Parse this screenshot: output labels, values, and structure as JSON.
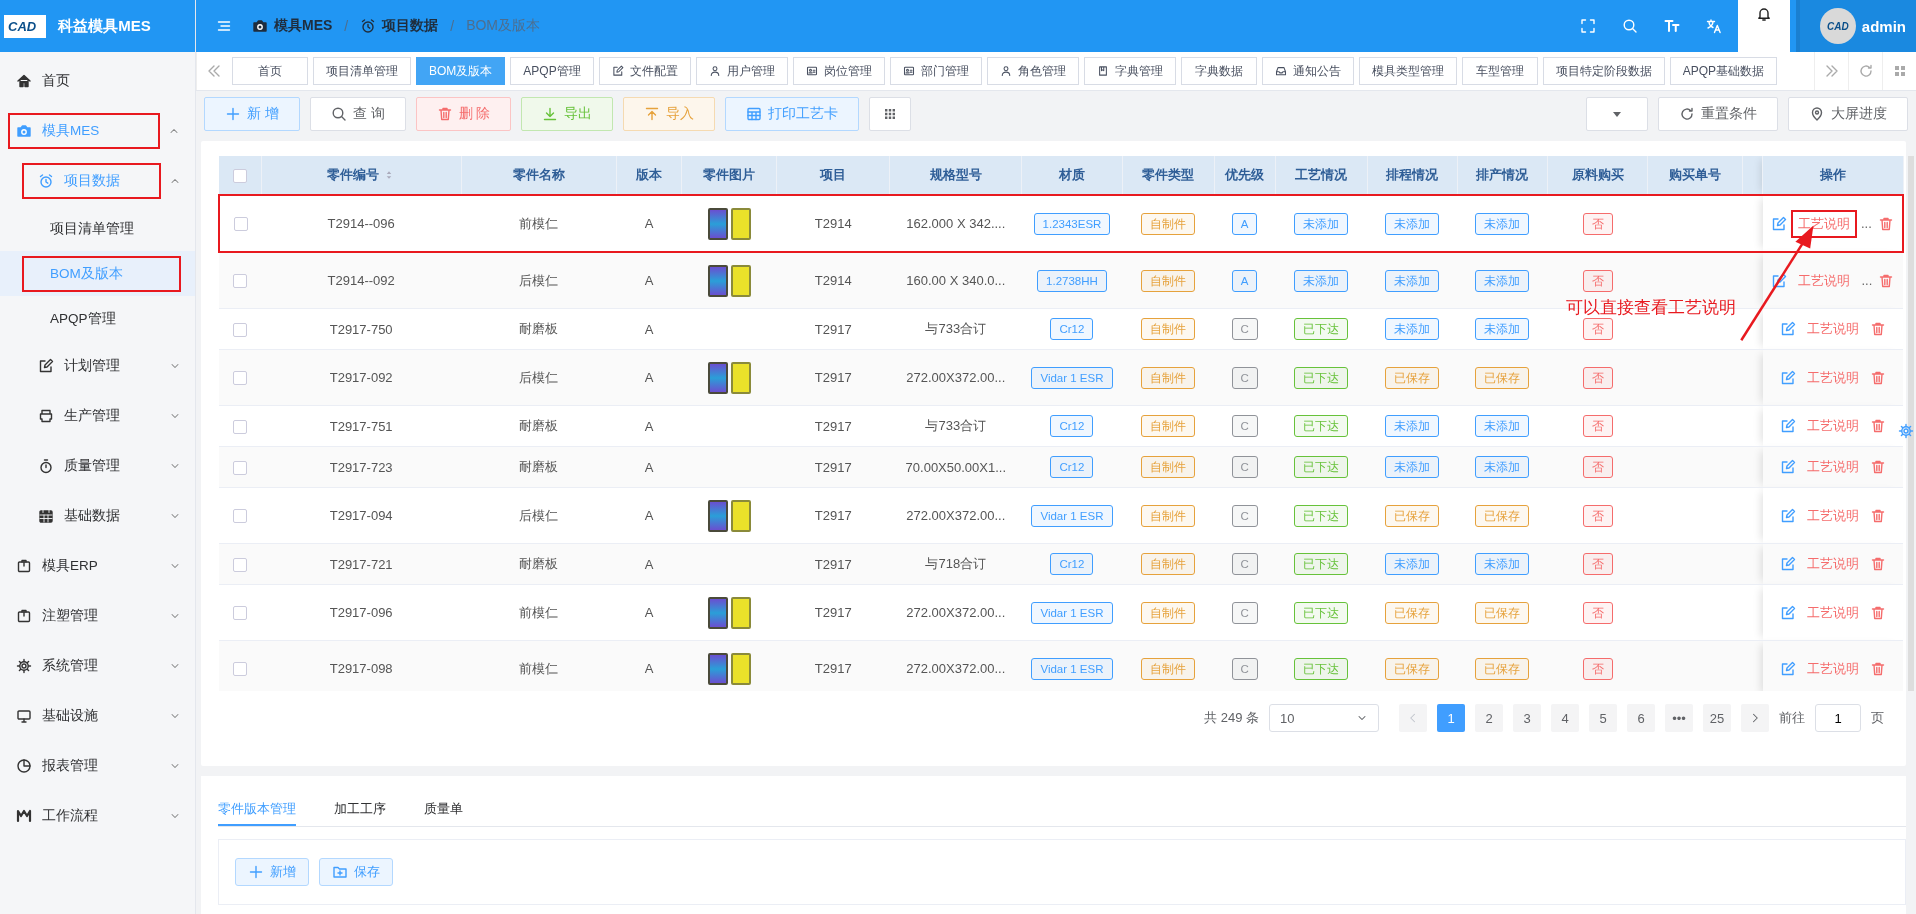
{
  "sidebar": {
    "logo_text": "CAD",
    "title": "科益模具MES",
    "items": [
      {
        "label": "首页",
        "selected": false,
        "highlighted": false
      },
      {
        "label": "模具MES",
        "selected": false,
        "expanded": true,
        "highlighted": true,
        "children": [
          {
            "label": "项目数据",
            "selected": false,
            "expanded": true,
            "highlighted": true,
            "children": [
              {
                "label": "项目清单管理",
                "selected": false,
                "highlighted": false
              },
              {
                "label": "BOM及版本",
                "selected": true,
                "highlighted": true
              },
              {
                "label": "APQP管理",
                "selected": false,
                "highlighted": false
              }
            ]
          },
          {
            "label": "计划管理",
            "selected": false,
            "expanded": false,
            "highlighted": false
          },
          {
            "label": "生产管理",
            "selected": false,
            "expanded": false,
            "highlighted": false
          },
          {
            "label": "质量管理",
            "selected": false,
            "expanded": false,
            "highlighted": false
          },
          {
            "label": "基础数据",
            "selected": false,
            "expanded": false,
            "highlighted": false
          }
        ]
      },
      {
        "label": "模具ERP",
        "selected": false,
        "expanded": false,
        "highlighted": false
      },
      {
        "label": "注塑管理",
        "selected": false,
        "expanded": false,
        "highlighted": false
      },
      {
        "label": "系统管理",
        "selected": false,
        "expanded": false,
        "highlighted": false
      },
      {
        "label": "基础设施",
        "selected": false,
        "expanded": false,
        "highlighted": false
      },
      {
        "label": "报表管理",
        "selected": false,
        "expanded": false,
        "highlighted": false
      },
      {
        "label": "工作流程",
        "selected": false,
        "expanded": false,
        "highlighted": false
      }
    ]
  },
  "header": {
    "breadcrumb": [
      "模具MES",
      "项目数据",
      "BOM及版本"
    ],
    "breadcrumb_separator": "/",
    "avatar_text": "CAD",
    "user": "admin"
  },
  "tabs": [
    {
      "label": "首页",
      "selected": false,
      "has_icon": false
    },
    {
      "label": "项目清单管理",
      "selected": false,
      "has_icon": false
    },
    {
      "label": "BOM及版本",
      "selected": true,
      "has_icon": false
    },
    {
      "label": "APQP管理",
      "selected": false,
      "has_icon": false
    },
    {
      "label": "文件配置",
      "selected": false,
      "has_icon": true
    },
    {
      "label": "用户管理",
      "selected": false,
      "has_icon": true
    },
    {
      "label": "岗位管理",
      "selected": false,
      "has_icon": true
    },
    {
      "label": "部门管理",
      "selected": false,
      "has_icon": true
    },
    {
      "label": "角色管理",
      "selected": false,
      "has_icon": true
    },
    {
      "label": "字典管理",
      "selected": false,
      "has_icon": true
    },
    {
      "label": "字典数据",
      "selected": false,
      "has_icon": false
    },
    {
      "label": "通知公告",
      "selected": false,
      "has_icon": true
    },
    {
      "label": "模具类型管理",
      "selected": false,
      "has_icon": false
    },
    {
      "label": "车型管理",
      "selected": false,
      "has_icon": false
    },
    {
      "label": "项目特定阶段数据",
      "selected": false,
      "has_icon": false
    },
    {
      "label": "APQP基础数据",
      "selected": false,
      "has_icon": false
    }
  ],
  "toolbar": {
    "left": [
      {
        "label": "新 增",
        "kind": "primary"
      },
      {
        "label": "查 询",
        "kind": "default"
      },
      {
        "label": "删 除",
        "kind": "danger"
      },
      {
        "label": "导出",
        "kind": "success"
      },
      {
        "label": "导入",
        "kind": "warning"
      },
      {
        "label": "打印工艺卡",
        "kind": "primary"
      }
    ],
    "right": [
      {
        "label": "重置条件"
      },
      {
        "label": "大屏进度"
      }
    ]
  },
  "table": {
    "header_checked": false,
    "columns": [
      {
        "label": "零件编号",
        "sortable": true
      },
      {
        "label": "零件名称",
        "sortable": false
      },
      {
        "label": "版本",
        "sortable": false
      },
      {
        "label": "零件图片",
        "sortable": false
      },
      {
        "label": "项目",
        "sortable": false
      },
      {
        "label": "规格型号",
        "sortable": false
      },
      {
        "label": "材质",
        "sortable": false
      },
      {
        "label": "零件类型",
        "sortable": false
      },
      {
        "label": "优先级",
        "sortable": false
      },
      {
        "label": "工艺情况",
        "sortable": false
      },
      {
        "label": "排程情况",
        "sortable": false
      },
      {
        "label": "排产情况",
        "sortable": false
      },
      {
        "label": "原料购买",
        "sortable": false
      },
      {
        "label": "购买单号",
        "sortable": false
      }
    ],
    "action_column": "操作",
    "rows": [
      {
        "checked": false,
        "highlighted": true,
        "link": "工艺说明",
        "more": "...",
        "cells": [
          {
            "kind": "text",
            "text": "T2914--096"
          },
          {
            "kind": "text",
            "text": "前模仁"
          },
          {
            "kind": "text",
            "text": "A"
          },
          {
            "kind": "image"
          },
          {
            "kind": "text",
            "text": "T2914"
          },
          {
            "kind": "text",
            "text": "162.000 X 342...."
          },
          {
            "kind": "tag",
            "text": "1.2343ESR",
            "color": "#409eff"
          },
          {
            "kind": "tag",
            "text": "自制件",
            "color": "#e6a23c"
          },
          {
            "kind": "tag",
            "text": "A",
            "color": "#409eff"
          },
          {
            "kind": "tag",
            "text": "未添加",
            "color": "#409eff"
          },
          {
            "kind": "tag",
            "text": "未添加",
            "color": "#409eff"
          },
          {
            "kind": "tag",
            "text": "未添加",
            "color": "#409eff"
          },
          {
            "kind": "tag",
            "text": "否",
            "color": "#f56c6c"
          },
          {
            "kind": "empty"
          }
        ]
      },
      {
        "checked": false,
        "highlighted": false,
        "link": "工艺说明",
        "more": "...",
        "cells": [
          {
            "kind": "text",
            "text": "T2914--092"
          },
          {
            "kind": "text",
            "text": "后模仁"
          },
          {
            "kind": "text",
            "text": "A"
          },
          {
            "kind": "image"
          },
          {
            "kind": "text",
            "text": "T2914"
          },
          {
            "kind": "text",
            "text": "160.00 X 340.0..."
          },
          {
            "kind": "tag",
            "text": "1.2738HH",
            "color": "#409eff"
          },
          {
            "kind": "tag",
            "text": "自制件",
            "color": "#e6a23c"
          },
          {
            "kind": "tag",
            "text": "A",
            "color": "#409eff"
          },
          {
            "kind": "tag",
            "text": "未添加",
            "color": "#409eff"
          },
          {
            "kind": "tag",
            "text": "未添加",
            "color": "#409eff"
          },
          {
            "kind": "tag",
            "text": "未添加",
            "color": "#409eff"
          },
          {
            "kind": "tag",
            "text": "否",
            "color": "#f56c6c"
          },
          {
            "kind": "empty"
          }
        ]
      },
      {
        "checked": false,
        "highlighted": false,
        "link": "工艺说明",
        "cells": [
          {
            "kind": "text",
            "text": "T2917-750"
          },
          {
            "kind": "text",
            "text": "耐磨板"
          },
          {
            "kind": "text",
            "text": "A"
          },
          {
            "kind": "empty"
          },
          {
            "kind": "text",
            "text": "T2917"
          },
          {
            "kind": "text",
            "text": "与733合订"
          },
          {
            "kind": "tag",
            "text": "Cr12",
            "color": "#409eff"
          },
          {
            "kind": "tag",
            "text": "自制件",
            "color": "#e6a23c"
          },
          {
            "kind": "tag",
            "text": "C",
            "color": "#909399"
          },
          {
            "kind": "tag",
            "text": "已下达",
            "color": "#67c23a"
          },
          {
            "kind": "tag",
            "text": "未添加",
            "color": "#409eff"
          },
          {
            "kind": "tag",
            "text": "未添加",
            "color": "#409eff"
          },
          {
            "kind": "tag",
            "text": "否",
            "color": "#f56c6c"
          },
          {
            "kind": "empty"
          }
        ]
      },
      {
        "checked": false,
        "highlighted": false,
        "link": "工艺说明",
        "cells": [
          {
            "kind": "text",
            "text": "T2917-092"
          },
          {
            "kind": "text",
            "text": "后模仁"
          },
          {
            "kind": "text",
            "text": "A"
          },
          {
            "kind": "image"
          },
          {
            "kind": "text",
            "text": "T2917"
          },
          {
            "kind": "text",
            "text": "272.00X372.00..."
          },
          {
            "kind": "tag",
            "text": "Vidar 1 ESR",
            "color": "#409eff"
          },
          {
            "kind": "tag",
            "text": "自制件",
            "color": "#e6a23c"
          },
          {
            "kind": "tag",
            "text": "C",
            "color": "#909399"
          },
          {
            "kind": "tag",
            "text": "已下达",
            "color": "#67c23a"
          },
          {
            "kind": "tag",
            "text": "已保存",
            "color": "#e6a23c"
          },
          {
            "kind": "tag",
            "text": "已保存",
            "color": "#e6a23c"
          },
          {
            "kind": "tag",
            "text": "否",
            "color": "#f56c6c"
          },
          {
            "kind": "empty"
          }
        ]
      },
      {
        "checked": false,
        "highlighted": false,
        "link": "工艺说明",
        "cells": [
          {
            "kind": "text",
            "text": "T2917-751"
          },
          {
            "kind": "text",
            "text": "耐磨板"
          },
          {
            "kind": "text",
            "text": "A"
          },
          {
            "kind": "empty"
          },
          {
            "kind": "text",
            "text": "T2917"
          },
          {
            "kind": "text",
            "text": "与733合订"
          },
          {
            "kind": "tag",
            "text": "Cr12",
            "color": "#409eff"
          },
          {
            "kind": "tag",
            "text": "自制件",
            "color": "#e6a23c"
          },
          {
            "kind": "tag",
            "text": "C",
            "color": "#909399"
          },
          {
            "kind": "tag",
            "text": "已下达",
            "color": "#67c23a"
          },
          {
            "kind": "tag",
            "text": "未添加",
            "color": "#409eff"
          },
          {
            "kind": "tag",
            "text": "未添加",
            "color": "#409eff"
          },
          {
            "kind": "tag",
            "text": "否",
            "color": "#f56c6c"
          },
          {
            "kind": "empty"
          }
        ]
      },
      {
        "checked": false,
        "highlighted": false,
        "link": "工艺说明",
        "cells": [
          {
            "kind": "text",
            "text": "T2917-723"
          },
          {
            "kind": "text",
            "text": "耐磨板"
          },
          {
            "kind": "text",
            "text": "A"
          },
          {
            "kind": "empty"
          },
          {
            "kind": "text",
            "text": "T2917"
          },
          {
            "kind": "text",
            "text": "70.00X50.00X1..."
          },
          {
            "kind": "tag",
            "text": "Cr12",
            "color": "#409eff"
          },
          {
            "kind": "tag",
            "text": "自制件",
            "color": "#e6a23c"
          },
          {
            "kind": "tag",
            "text": "C",
            "color": "#909399"
          },
          {
            "kind": "tag",
            "text": "已下达",
            "color": "#67c23a"
          },
          {
            "kind": "tag",
            "text": "未添加",
            "color": "#409eff"
          },
          {
            "kind": "tag",
            "text": "未添加",
            "color": "#409eff"
          },
          {
            "kind": "tag",
            "text": "否",
            "color": "#f56c6c"
          },
          {
            "kind": "empty"
          }
        ]
      },
      {
        "checked": false,
        "highlighted": false,
        "link": "工艺说明",
        "cells": [
          {
            "kind": "text",
            "text": "T2917-094"
          },
          {
            "kind": "text",
            "text": "后模仁"
          },
          {
            "kind": "text",
            "text": "A"
          },
          {
            "kind": "image"
          },
          {
            "kind": "text",
            "text": "T2917"
          },
          {
            "kind": "text",
            "text": "272.00X372.00..."
          },
          {
            "kind": "tag",
            "text": "Vidar 1 ESR",
            "color": "#409eff"
          },
          {
            "kind": "tag",
            "text": "自制件",
            "color": "#e6a23c"
          },
          {
            "kind": "tag",
            "text": "C",
            "color": "#909399"
          },
          {
            "kind": "tag",
            "text": "已下达",
            "color": "#67c23a"
          },
          {
            "kind": "tag",
            "text": "已保存",
            "color": "#e6a23c"
          },
          {
            "kind": "tag",
            "text": "已保存",
            "color": "#e6a23c"
          },
          {
            "kind": "tag",
            "text": "否",
            "color": "#f56c6c"
          },
          {
            "kind": "empty"
          }
        ]
      },
      {
        "checked": false,
        "highlighted": false,
        "link": "工艺说明",
        "cells": [
          {
            "kind": "text",
            "text": "T2917-721"
          },
          {
            "kind": "text",
            "text": "耐磨板"
          },
          {
            "kind": "text",
            "text": "A"
          },
          {
            "kind": "empty"
          },
          {
            "kind": "text",
            "text": "T2917"
          },
          {
            "kind": "text",
            "text": "与718合订"
          },
          {
            "kind": "tag",
            "text": "Cr12",
            "color": "#409eff"
          },
          {
            "kind": "tag",
            "text": "自制件",
            "color": "#e6a23c"
          },
          {
            "kind": "tag",
            "text": "C",
            "color": "#909399"
          },
          {
            "kind": "tag",
            "text": "已下达",
            "color": "#67c23a"
          },
          {
            "kind": "tag",
            "text": "未添加",
            "color": "#409eff"
          },
          {
            "kind": "tag",
            "text": "未添加",
            "color": "#409eff"
          },
          {
            "kind": "tag",
            "text": "否",
            "color": "#f56c6c"
          },
          {
            "kind": "empty"
          }
        ]
      },
      {
        "checked": false,
        "highlighted": false,
        "link": "工艺说明",
        "cells": [
          {
            "kind": "text",
            "text": "T2917-096"
          },
          {
            "kind": "text",
            "text": "前模仁"
          },
          {
            "kind": "text",
            "text": "A"
          },
          {
            "kind": "image"
          },
          {
            "kind": "text",
            "text": "T2917"
          },
          {
            "kind": "text",
            "text": "272.00X372.00..."
          },
          {
            "kind": "tag",
            "text": "Vidar 1 ESR",
            "color": "#409eff"
          },
          {
            "kind": "tag",
            "text": "自制件",
            "color": "#e6a23c"
          },
          {
            "kind": "tag",
            "text": "C",
            "color": "#909399"
          },
          {
            "kind": "tag",
            "text": "已下达",
            "color": "#67c23a"
          },
          {
            "kind": "tag",
            "text": "已保存",
            "color": "#e6a23c"
          },
          {
            "kind": "tag",
            "text": "已保存",
            "color": "#e6a23c"
          },
          {
            "kind": "tag",
            "text": "否",
            "color": "#f56c6c"
          },
          {
            "kind": "empty"
          }
        ]
      },
      {
        "checked": false,
        "highlighted": false,
        "link": "工艺说明",
        "cells": [
          {
            "kind": "text",
            "text": "T2917-098"
          },
          {
            "kind": "text",
            "text": "前模仁"
          },
          {
            "kind": "text",
            "text": "A"
          },
          {
            "kind": "image"
          },
          {
            "kind": "text",
            "text": "T2917"
          },
          {
            "kind": "text",
            "text": "272.00X372.00..."
          },
          {
            "kind": "tag",
            "text": "Vidar 1 ESR",
            "color": "#409eff"
          },
          {
            "kind": "tag",
            "text": "自制件",
            "color": "#e6a23c"
          },
          {
            "kind": "tag",
            "text": "C",
            "color": "#909399"
          },
          {
            "kind": "tag",
            "text": "已下达",
            "color": "#67c23a"
          },
          {
            "kind": "tag",
            "text": "已保存",
            "color": "#e6a23c"
          },
          {
            "kind": "tag",
            "text": "已保存",
            "color": "#e6a23c"
          },
          {
            "kind": "tag",
            "text": "否",
            "color": "#f56c6c"
          },
          {
            "kind": "empty"
          }
        ]
      }
    ]
  },
  "pagination": {
    "total": "共 249 条",
    "page_size": "10",
    "pages": [
      {
        "label": "1",
        "selected": true
      },
      {
        "label": "2",
        "selected": false
      },
      {
        "label": "3",
        "selected": false
      },
      {
        "label": "4",
        "selected": false
      },
      {
        "label": "5",
        "selected": false
      },
      {
        "label": "6",
        "selected": false
      },
      {
        "label": "•••",
        "selected": false
      },
      {
        "label": "25",
        "selected": false
      }
    ],
    "goto_label": "前往",
    "goto_value": "1",
    "page_unit": "页"
  },
  "annotation": {
    "text": "可以直接查看工艺说明"
  },
  "detail": {
    "tabs": [
      {
        "label": "零件版本管理",
        "selected": true
      },
      {
        "label": "加工工序",
        "selected": false
      },
      {
        "label": "质量单",
        "selected": false
      }
    ],
    "buttons": [
      "新增",
      "保存"
    ]
  }
}
